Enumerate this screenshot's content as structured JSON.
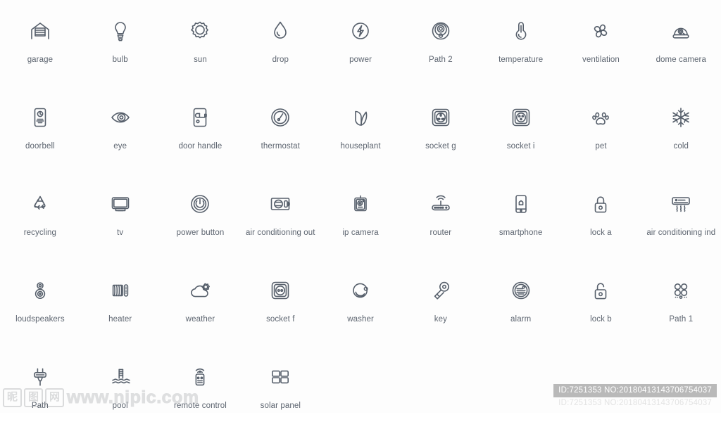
{
  "page": {
    "background": "#ffffff",
    "icon_color": "#565f6b",
    "label_color": "#5d6570"
  },
  "icons": [
    {
      "label": "garage",
      "icon": "garage-icon"
    },
    {
      "label": "bulb",
      "icon": "bulb-icon"
    },
    {
      "label": "sun",
      "icon": "sun-icon"
    },
    {
      "label": "drop",
      "icon": "drop-icon"
    },
    {
      "label": "power",
      "icon": "power-icon"
    },
    {
      "label": "Path 2",
      "icon": "robot-vacuum-icon"
    },
    {
      "label": "temperature",
      "icon": "thermometer-icon"
    },
    {
      "label": "ventilation",
      "icon": "fan-icon"
    },
    {
      "label": "dome camera",
      "icon": "dome-camera-icon"
    },
    {
      "label": "doorbell",
      "icon": "doorbell-icon"
    },
    {
      "label": "eye",
      "icon": "eye-icon"
    },
    {
      "label": "door handle",
      "icon": "door-handle-icon"
    },
    {
      "label": "thermostat",
      "icon": "thermostat-icon"
    },
    {
      "label": "houseplant",
      "icon": "leaf-icon"
    },
    {
      "label": "socket g",
      "icon": "socket-g-icon"
    },
    {
      "label": "socket i",
      "icon": "socket-i-icon"
    },
    {
      "label": "pet",
      "icon": "paw-icon"
    },
    {
      "label": "cold",
      "icon": "snowflake-icon"
    },
    {
      "label": "recycling",
      "icon": "recycling-icon"
    },
    {
      "label": "tv",
      "icon": "tv-icon"
    },
    {
      "label": "power button",
      "icon": "power-button-icon"
    },
    {
      "label": "air conditioning out",
      "icon": "ac-outdoor-icon"
    },
    {
      "label": "ip camera",
      "icon": "ip-camera-icon"
    },
    {
      "label": "router",
      "icon": "router-icon"
    },
    {
      "label": "smartphone",
      "icon": "smartphone-icon"
    },
    {
      "label": "lock a",
      "icon": "lock-closed-icon"
    },
    {
      "label": "air conditioning ind",
      "icon": "ac-indoor-icon"
    },
    {
      "label": "loudspeakers",
      "icon": "loudspeaker-icon"
    },
    {
      "label": "heater",
      "icon": "radiator-icon"
    },
    {
      "label": "weather",
      "icon": "cloud-sun-icon"
    },
    {
      "label": "socket f",
      "icon": "socket-f-icon"
    },
    {
      "label": "washer",
      "icon": "washer-icon"
    },
    {
      "label": "key",
      "icon": "key-icon"
    },
    {
      "label": "alarm",
      "icon": "alarm-icon"
    },
    {
      "label": "lock b",
      "icon": "lock-open-icon"
    },
    {
      "label": "Path 1",
      "icon": "hob-icon"
    },
    {
      "label": "Path",
      "icon": "plug-icon"
    },
    {
      "label": "pool",
      "icon": "pool-icon"
    },
    {
      "label": "remote control",
      "icon": "remote-control-icon"
    },
    {
      "label": "solar panel",
      "icon": "solar-panel-icon"
    }
  ],
  "watermark": {
    "cn_chars": [
      "昵",
      "图",
      "网"
    ],
    "url": "www.nipic.com",
    "id_text": "ID:7251353 NO:20180413143706754037"
  }
}
